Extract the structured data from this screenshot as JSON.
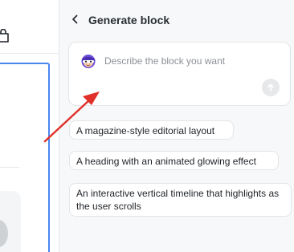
{
  "panel": {
    "title": "Generate block",
    "back_icon": "chevron-left-icon"
  },
  "prompt": {
    "placeholder": "Describe the block you want",
    "value": "",
    "avatar_icon": "ai-assistant-avatar-icon",
    "send_icon": "arrow-up-icon"
  },
  "suggestions": [
    {
      "label": "A magazine-style editorial layout"
    },
    {
      "label": "A heading with an animated glowing effect"
    },
    {
      "label": "An interactive vertical timeline that highlights as the user scrolls"
    }
  ],
  "left": {
    "toolbar_icon": "shopping-bag-icon"
  },
  "colors": {
    "selection_outline": "#4a86f0",
    "annotation_arrow": "#e0302a",
    "panel_background": "#f7f8f9",
    "avatar_purple": "#6c4bd8"
  }
}
